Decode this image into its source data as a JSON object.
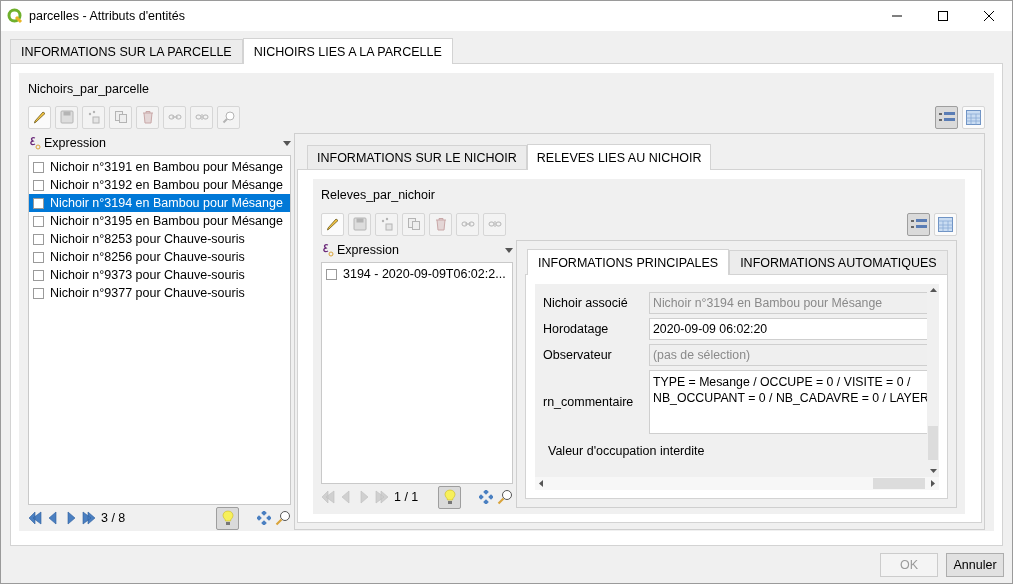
{
  "window": {
    "title": "parcelles - Attributs d'entités"
  },
  "tabs": [
    {
      "label": "INFORMATIONS SUR LA PARCELLE",
      "selected": false
    },
    {
      "label": "NICHOIRS LIES A LA PARCELLE",
      "selected": true
    }
  ],
  "relation": {
    "title": "Nichoirs_par_parcelle",
    "toolbar": [
      {
        "kind": "edit",
        "disabled": false
      },
      {
        "kind": "save",
        "disabled": true
      },
      {
        "kind": "add",
        "disabled": true
      },
      {
        "kind": "duplicate",
        "disabled": true
      },
      {
        "kind": "delete",
        "disabled": true
      },
      {
        "kind": "link",
        "disabled": true
      },
      {
        "kind": "unlink",
        "disabled": true
      },
      {
        "kind": "zoom",
        "disabled": true
      }
    ],
    "views": [
      {
        "kind": "form",
        "selected": true
      },
      {
        "kind": "table",
        "selected": false
      }
    ],
    "list_header": "Expression",
    "items": [
      {
        "label": "Nichoir n°3191 en Bambou pour Mésange",
        "checked": false,
        "selected": false
      },
      {
        "label": "Nichoir n°3192 en Bambou pour Mésange",
        "checked": false,
        "selected": false
      },
      {
        "label": "Nichoir n°3194 en Bambou pour Mésange",
        "checked": false,
        "selected": true
      },
      {
        "label": "Nichoir n°3195 en Bambou pour Mésange",
        "checked": false,
        "selected": false
      },
      {
        "label": "Nichoir n°8253 pour Chauve-souris",
        "checked": false,
        "selected": false
      },
      {
        "label": "Nichoir n°8256 pour Chauve-souris",
        "checked": false,
        "selected": false
      },
      {
        "label": "Nichoir n°9373 pour Chauve-souris",
        "checked": false,
        "selected": false
      },
      {
        "label": "Nichoir n°9377 pour Chauve-souris",
        "checked": false,
        "selected": false
      }
    ],
    "nav": {
      "counter": "3 / 8",
      "disabled": false,
      "highlight": true
    },
    "tabs": [
      {
        "label": "INFORMATIONS SUR LE NICHOIR",
        "selected": false
      },
      {
        "label": "RELEVES LIES AU NICHOIR",
        "selected": true
      }
    ],
    "relation": {
      "title": "Releves_par_nichoir",
      "toolbar": [
        {
          "kind": "edit",
          "disabled": false
        },
        {
          "kind": "save",
          "disabled": true
        },
        {
          "kind": "add",
          "disabled": true
        },
        {
          "kind": "duplicate",
          "disabled": true
        },
        {
          "kind": "delete",
          "disabled": true
        },
        {
          "kind": "link",
          "disabled": true
        },
        {
          "kind": "unlink",
          "disabled": true
        }
      ],
      "views": [
        {
          "kind": "form",
          "selected": true
        },
        {
          "kind": "table",
          "selected": false
        }
      ],
      "list_header": "Expression",
      "items": [
        {
          "label": "3194 - 2020-09-09T06:02:2...",
          "checked": false,
          "selected": false
        }
      ],
      "nav": {
        "counter": "1 / 1",
        "disabled": true,
        "highlight": true
      },
      "tabs": [
        {
          "label": "INFORMATIONS PRINCIPALES",
          "selected": true
        },
        {
          "label": "INFORMATIONS AUTOMATIQUES",
          "selected": false
        }
      ],
      "fields": [
        {
          "kind": "text",
          "label": "Nichoir associé",
          "value": "Nichoir n°3194 en Bambou pour Mésange",
          "disabled": true
        },
        {
          "kind": "text",
          "label": "Horodatage",
          "value": "2020-09-09 06:02:20",
          "disabled": false
        },
        {
          "kind": "combo",
          "label": "Observateur",
          "value": "(pas de sélection)",
          "disabled": true
        },
        {
          "kind": "multiline",
          "label": "rn_commentaire",
          "value": "TYPE = Mesange / OCCUPE = 0 / VISITE = 0 /\nNB_OCCUPANT = 0 / NB_CADAVRE = 0 / LAYER",
          "disabled": false
        },
        {
          "kind": "section",
          "label": "Valeur d'occupation interdite"
        }
      ]
    }
  },
  "buttons": [
    {
      "label": "OK",
      "disabled": true
    },
    {
      "label": "Annuler",
      "disabled": false
    }
  ]
}
